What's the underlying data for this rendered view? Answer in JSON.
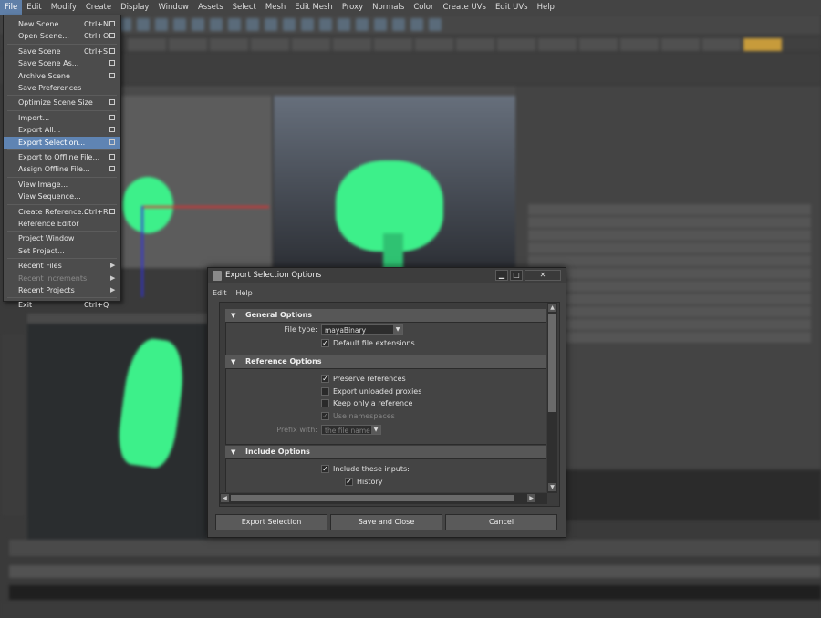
{
  "menubar": [
    "File",
    "Edit",
    "Modify",
    "Create",
    "Display",
    "Window",
    "Assets",
    "Select",
    "Mesh",
    "Edit Mesh",
    "Proxy",
    "Normals",
    "Color",
    "Create UVs",
    "Edit UVs",
    "Help"
  ],
  "file_menu": [
    {
      "label": "New Scene",
      "shortcut": "Ctrl+N",
      "option": true
    },
    {
      "label": "Open Scene...",
      "shortcut": "Ctrl+O",
      "option": true
    },
    {
      "sep": true
    },
    {
      "label": "Save Scene",
      "shortcut": "Ctrl+S",
      "option": true
    },
    {
      "label": "Save Scene As...",
      "shortcut": "",
      "option": true
    },
    {
      "label": "Archive Scene",
      "shortcut": "",
      "option": true
    },
    {
      "label": "Save Preferences",
      "shortcut": "",
      "option": false
    },
    {
      "sep": true
    },
    {
      "label": "Optimize Scene Size",
      "shortcut": "",
      "option": true
    },
    {
      "sep": true
    },
    {
      "label": "Import...",
      "shortcut": "",
      "option": true
    },
    {
      "label": "Export All...",
      "shortcut": "",
      "option": true
    },
    {
      "label": "Export Selection...",
      "shortcut": "",
      "option": true,
      "highlight": true
    },
    {
      "sep": true
    },
    {
      "label": "Export to Offline File...",
      "shortcut": "",
      "option": true
    },
    {
      "label": "Assign Offline File...",
      "shortcut": "",
      "option": true
    },
    {
      "sep": true
    },
    {
      "label": "View Image...",
      "shortcut": "",
      "option": false
    },
    {
      "label": "View Sequence...",
      "shortcut": "",
      "option": false
    },
    {
      "sep": true
    },
    {
      "label": "Create Reference...",
      "shortcut": "Ctrl+R",
      "option": true
    },
    {
      "label": "Reference Editor",
      "shortcut": "",
      "option": false
    },
    {
      "sep": true
    },
    {
      "label": "Project Window",
      "shortcut": "",
      "option": false
    },
    {
      "label": "Set Project...",
      "shortcut": "",
      "option": false
    },
    {
      "sep": true
    },
    {
      "label": "Recent Files",
      "shortcut": "",
      "submenu": true
    },
    {
      "label": "Recent Increments",
      "shortcut": "",
      "submenu": true,
      "disabled": true
    },
    {
      "label": "Recent Projects",
      "shortcut": "",
      "submenu": true
    },
    {
      "sep": true
    },
    {
      "label": "Exit",
      "shortcut": "Ctrl+Q",
      "option": false
    }
  ],
  "dialog": {
    "title": "Export Selection Options",
    "menu": [
      "Edit",
      "Help"
    ],
    "sections": {
      "general": "General Options",
      "reference": "Reference Options",
      "include": "Include Options"
    },
    "file_type_label": "File type:",
    "file_type_value": "mayaBinary",
    "default_ext_label": "Default file extensions",
    "preserve_refs": "Preserve references",
    "export_unloaded": "Export unloaded proxies",
    "keep_only_ref": "Keep only a reference",
    "use_namespaces": "Use namespaces",
    "prefix_label": "Prefix with:",
    "prefix_value": "the file name",
    "include_inputs": "Include these inputs:",
    "history": "History",
    "buttons": {
      "export": "Export Selection",
      "save_close": "Save and Close",
      "cancel": "Cancel"
    }
  },
  "colors": {
    "accent": "#5f84b3",
    "tree": "#3df08a",
    "shelf_sel": "#c79b3b"
  }
}
